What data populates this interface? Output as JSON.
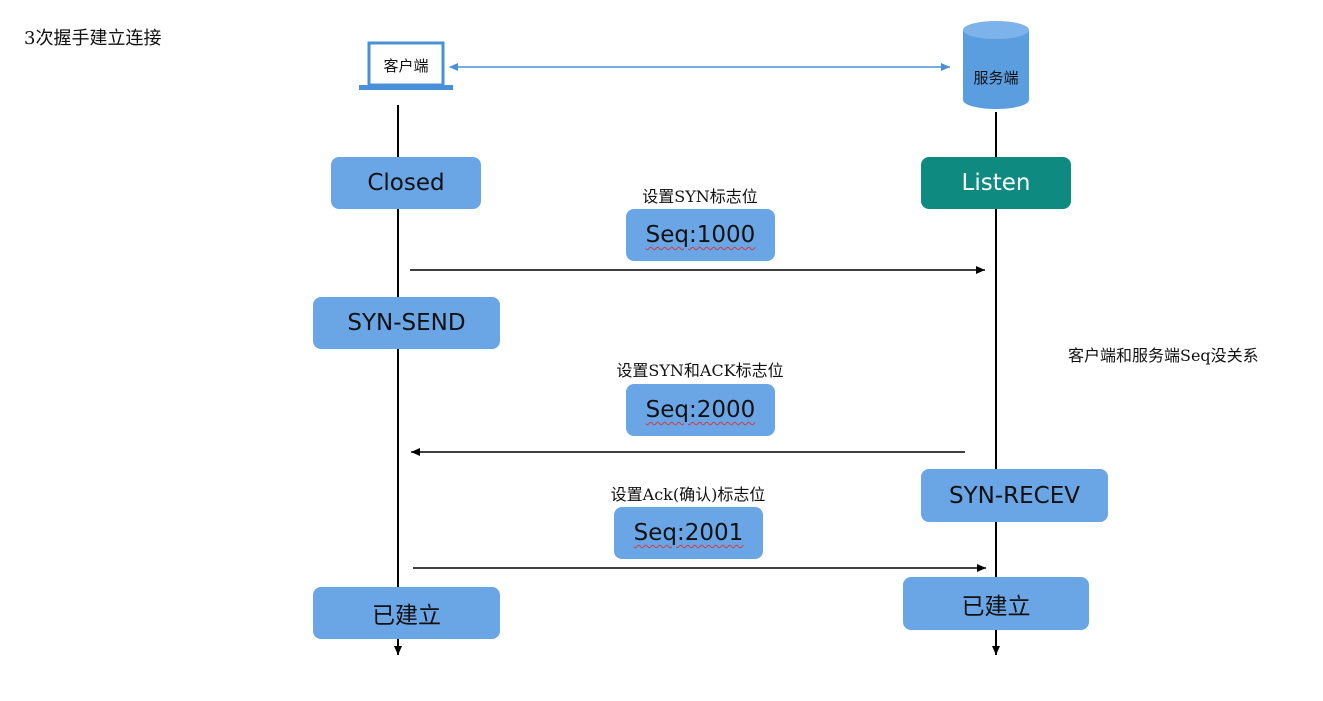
{
  "title": "3次握手建立连接",
  "client": {
    "label": "客户端"
  },
  "server": {
    "label": "服务端"
  },
  "side_note": "客户端和服务端Seq没关系",
  "client_states": {
    "closed": "Closed",
    "syn_send": "SYN-SEND",
    "established": "已建立"
  },
  "server_states": {
    "listen": "Listen",
    "syn_recev": "SYN-RECEV",
    "established": "已建立"
  },
  "messages": [
    {
      "note": "设置SYN标志位",
      "seq": "Seq:1000",
      "direction": "client-to-server"
    },
    {
      "note": "设置SYN和ACK标志位",
      "seq": "Seq:2000",
      "direction": "server-to-client"
    },
    {
      "note": "设置Ack(确认)标志位",
      "seq": "Seq:2001",
      "direction": "client-to-server"
    }
  ],
  "colors": {
    "state_box": "#6aa5e5",
    "listen_box": "#0e8a80",
    "cylinder": "#5b9ee0",
    "connector": "#4a90d9"
  },
  "icons": {
    "client": "laptop-icon",
    "server": "database-icon"
  }
}
